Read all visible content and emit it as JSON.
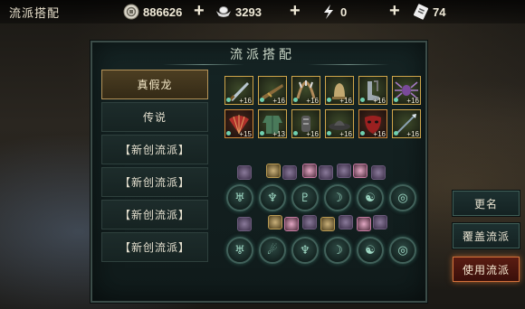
{
  "topbar": {
    "title": "流派搭配",
    "resources": [
      {
        "icon": "coin-icon",
        "value": "886626"
      },
      {
        "icon": "ingot-icon",
        "value": "3293"
      },
      {
        "icon": "stamina-icon",
        "value": "0"
      },
      {
        "icon": "ticket-icon",
        "value": "74"
      }
    ],
    "plus": "+"
  },
  "panel": {
    "title": "流派搭配",
    "schools": [
      {
        "label": "真假龙",
        "active": true
      },
      {
        "label": "传说",
        "active": false
      },
      {
        "label": "【新创流派】",
        "active": false
      },
      {
        "label": "【新创流派】",
        "active": false
      },
      {
        "label": "【新创流派】",
        "active": false
      },
      {
        "label": "【新创流派】",
        "active": false
      }
    ],
    "equipment_row1": [
      {
        "icon": "blade-icon",
        "level": "+16"
      },
      {
        "icon": "rifle-icon",
        "level": "+16"
      },
      {
        "icon": "claw-icon",
        "level": "+16"
      },
      {
        "icon": "bell-icon",
        "level": "+16"
      },
      {
        "icon": "boots-icon",
        "level": "+16"
      },
      {
        "icon": "spider-icon",
        "level": "+16"
      }
    ],
    "equipment_row2": [
      {
        "icon": "fan-icon",
        "level": "+15"
      },
      {
        "icon": "robe-icon",
        "level": "+13"
      },
      {
        "icon": "gauntlet-icon",
        "level": "+16"
      },
      {
        "icon": "hat-icon",
        "level": "+16"
      },
      {
        "icon": "mask-icon",
        "level": "+16"
      },
      {
        "icon": "spear-icon",
        "level": "+16"
      }
    ]
  },
  "buttons": {
    "rename": "更名",
    "overwrite": "覆盖流派",
    "use": "使用流派"
  },
  "colors": {
    "accent_gold": "#cfa54a",
    "panel_bg": "#152424",
    "primary_btn": "#d4713a"
  }
}
